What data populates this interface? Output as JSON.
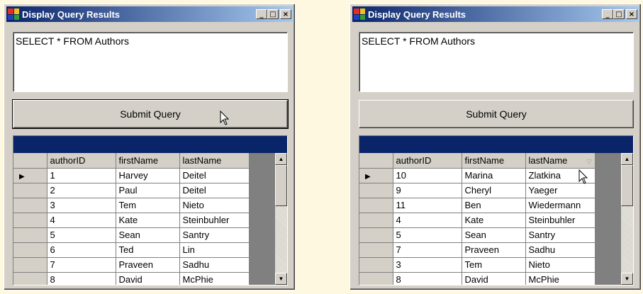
{
  "windows": [
    {
      "title": "Display Query Results",
      "query_text": "SELECT * FROM Authors",
      "submit_label": "Submit Query",
      "columns": [
        "authorID",
        "firstName",
        "lastName"
      ],
      "rows": [
        [
          "1",
          "Harvey",
          "Deitel"
        ],
        [
          "2",
          "Paul",
          "Deitel"
        ],
        [
          "3",
          "Tem",
          "Nieto"
        ],
        [
          "4",
          "Kate",
          "Steinbuhler"
        ],
        [
          "5",
          "Sean",
          "Santry"
        ],
        [
          "6",
          "Ted",
          "Lin"
        ],
        [
          "7",
          "Praveen",
          "Sadhu"
        ],
        [
          "8",
          "David",
          "McPhie"
        ]
      ]
    },
    {
      "title": "Display Query Results",
      "query_text": "SELECT * FROM Authors",
      "submit_label": "Submit Query",
      "columns": [
        "authorID",
        "firstName",
        "lastName"
      ],
      "rows": [
        [
          "10",
          "Marina",
          "Zlatkina"
        ],
        [
          "9",
          "Cheryl",
          "Yaeger"
        ],
        [
          "11",
          "Ben",
          "Wiedermann"
        ],
        [
          "4",
          "Kate",
          "Steinbuhler"
        ],
        [
          "5",
          "Sean",
          "Santry"
        ],
        [
          "7",
          "Praveen",
          "Sadhu"
        ],
        [
          "3",
          "Tem",
          "Nieto"
        ],
        [
          "8",
          "David",
          "McPhie"
        ]
      ]
    }
  ],
  "caption_buttons": {
    "minimize": "_",
    "maximize": "□",
    "close": "×"
  },
  "icons": {
    "row_pointer": "row-pointer-icon",
    "sort_indicator": "sort-ascending-icon",
    "scroll_up": "scroll-up-icon",
    "scroll_down": "scroll-down-icon",
    "cursor": "mouse-cursor-icon"
  },
  "colors": {
    "title_start": "#0a246a",
    "title_end": "#a6caf0",
    "caption": "#0a246a",
    "window": "#d4d0c8"
  }
}
